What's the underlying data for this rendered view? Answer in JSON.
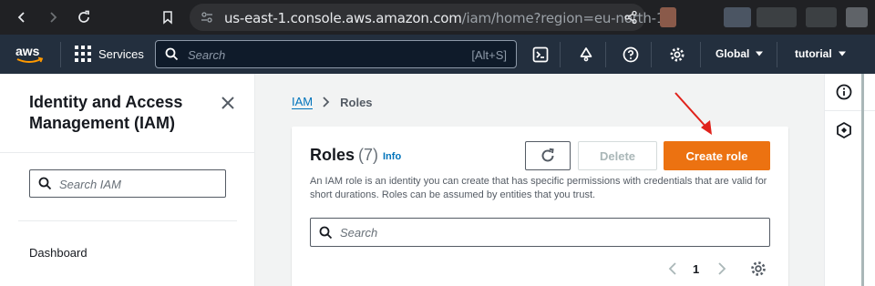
{
  "browser": {
    "url_host": "us-east-1.console.aws.amazon.com",
    "url_path": "/iam/home?region=eu-north-1..."
  },
  "topnav": {
    "services_label": "Services",
    "search_placeholder": "Search",
    "search_shortcut": "[Alt+S]",
    "region_label": "Global",
    "account_label": "tutorial"
  },
  "sidebar": {
    "title": "Identity and Access Management (IAM)",
    "search_placeholder": "Search IAM",
    "items": [
      {
        "label": "Dashboard"
      }
    ]
  },
  "breadcrumb": {
    "root": "IAM",
    "current": "Roles"
  },
  "roles_panel": {
    "title": "Roles",
    "count": "(7)",
    "info_label": "Info",
    "delete_label": "Delete",
    "create_label": "Create role",
    "description": "An IAM role is an identity you can create that has specific permissions with credentials that are valid for short durations. Roles can be assumed by entities that you trust.",
    "search_placeholder": "Search",
    "page_number": "1"
  },
  "colors": {
    "accent_orange": "#ec7211",
    "link_blue": "#0073bb",
    "nav_bg": "#232f3e",
    "annotation_red": "#e0221b"
  }
}
